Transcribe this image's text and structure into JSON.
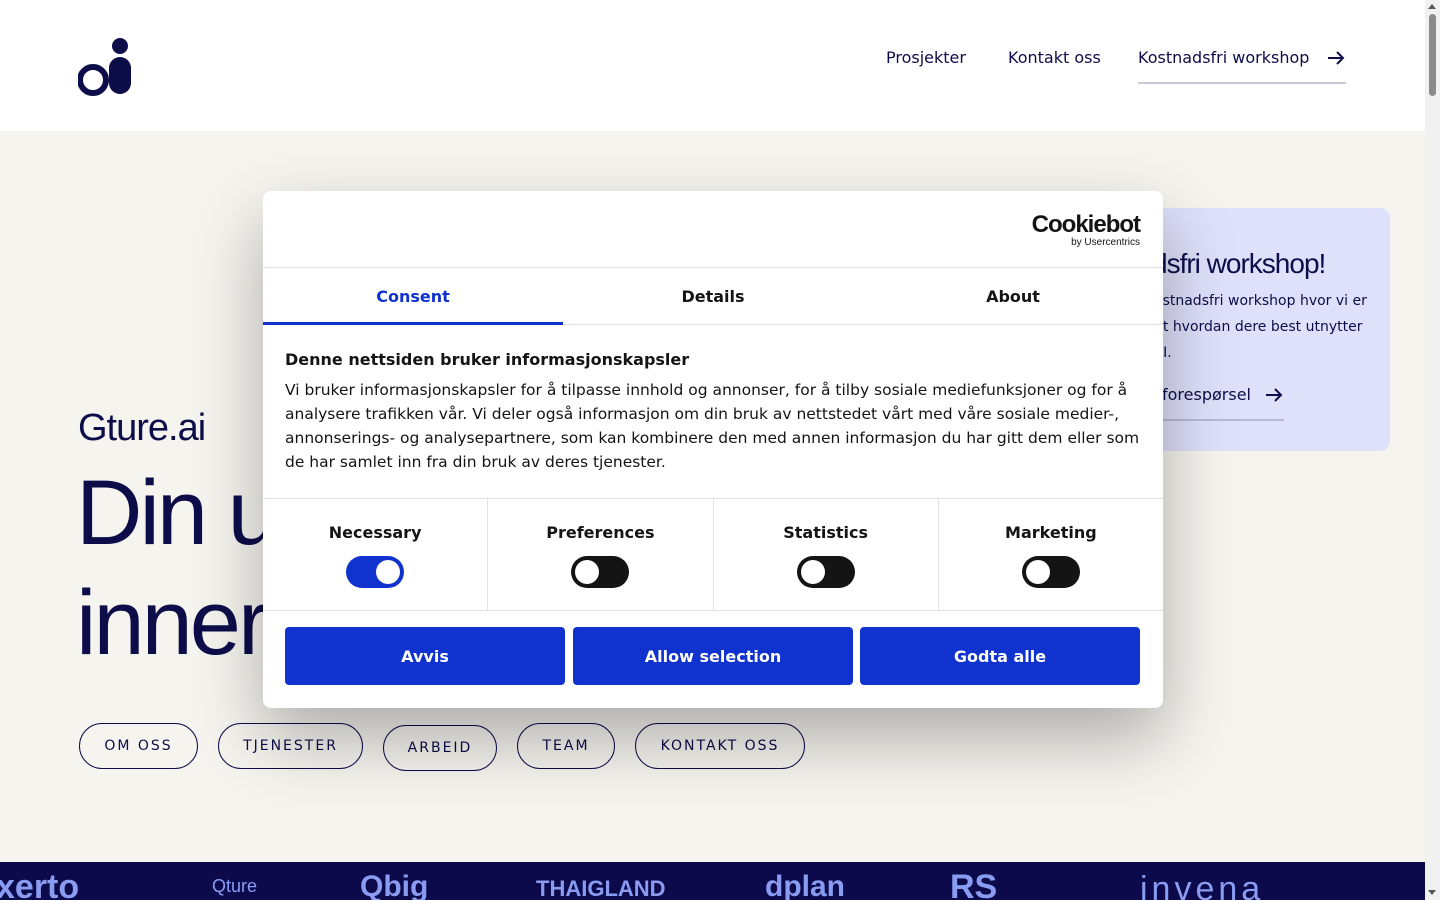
{
  "header": {
    "nav": {
      "projects": "Prosjekter",
      "contact": "Kontakt oss",
      "cta": "Kostnadsfri workshop"
    }
  },
  "hero": {
    "brand": "Gture.ai",
    "headline_line1": "Din u",
    "headline_line2": "inner",
    "pills": [
      "OM OSS",
      "TJENESTER",
      "ARBEID",
      "TEAM",
      "KONTAKT OSS"
    ],
    "promo": {
      "title": "dsfri workshop!",
      "text": "ostnadsfri workshop hvor vi er ut hvordan dere best utnytter KI.",
      "link": "forespørsel"
    }
  },
  "clients": [
    "xerto",
    "Qture",
    "Qbig",
    "THAIGLAND",
    "dplan",
    "RS",
    "invena"
  ],
  "cookie_dialog": {
    "brand_big": "Cookiebot",
    "brand_small": "by Usercentrics",
    "tabs": [
      "Consent",
      "Details",
      "About"
    ],
    "active_tab": "Consent",
    "title": "Denne nettsiden bruker informasjonskapsler",
    "body": "Vi bruker informasjonskapsler for å tilpasse innhold og annonser, for å tilby sosiale mediefunksjoner og for å analysere trafikken vår. Vi deler også informasjon om din bruk av nettstedet vårt med våre sosiale medier-, annonserings- og analysepartnere, som kan kombinere den med annen informasjon du har gitt dem eller som de har samlet inn fra din bruk av deres tjenester.",
    "toggles": [
      {
        "label": "Necessary",
        "on": true
      },
      {
        "label": "Preferences",
        "on": false
      },
      {
        "label": "Statistics",
        "on": false
      },
      {
        "label": "Marketing",
        "on": false
      }
    ],
    "buttons": {
      "reject": "Avvis",
      "allow_selection": "Allow selection",
      "accept_all": "Godta alle"
    }
  },
  "colors": {
    "navy": "#0d0d4a",
    "accent": "#1032cf",
    "hero_bg": "#f5f4ef",
    "promo_bg": "#dfe0fa",
    "band_bg": "#0c0a4a"
  }
}
